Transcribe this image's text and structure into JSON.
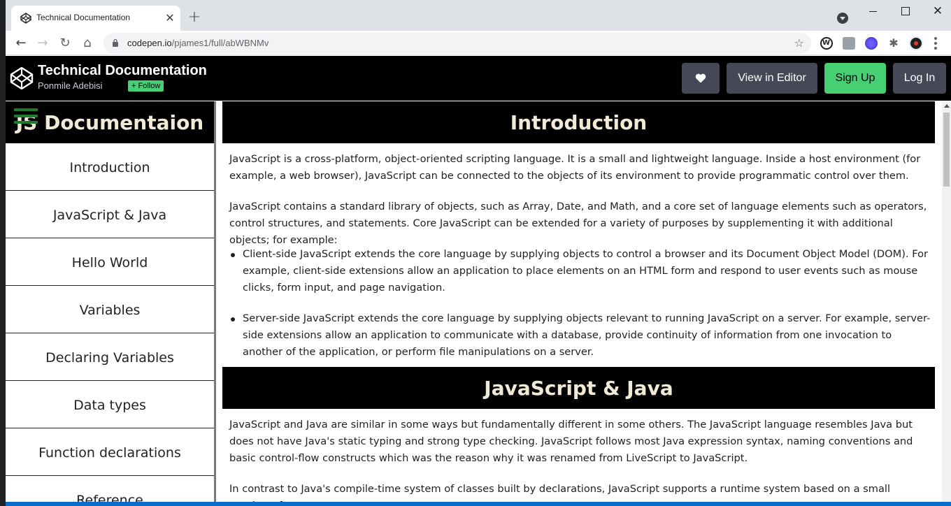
{
  "browser": {
    "tab_title": "Technical Documentation",
    "tab_close": "✕",
    "new_tab": "+",
    "url_host": "codepen.io",
    "url_path": "/pjames1/full/abWBNMv",
    "win_close": "✕"
  },
  "header": {
    "title": "Technical Documentation",
    "author": "Ponmile Adebisi",
    "follow_label": "+ Follow",
    "view_editor_label": "View in Editor",
    "signup_label": "Sign Up",
    "login_label": "Log In"
  },
  "nav": {
    "title": "JS Documentaion",
    "items": [
      {
        "label": "Introduction"
      },
      {
        "label": "JavaScript & Java"
      },
      {
        "label": "Hello World"
      },
      {
        "label": "Variables"
      },
      {
        "label": "Declaring Variables"
      },
      {
        "label": "Data types"
      },
      {
        "label": "Function declarations"
      },
      {
        "label": "Reference"
      }
    ]
  },
  "main": {
    "sections": [
      {
        "title": "Introduction",
        "paragraphs": [
          "JavaScript is a cross-platform, object-oriented scripting language. It is a small and lightweight language. Inside a host environment (for example, a web browser), JavaScript can be connected to the objects of its environment to provide programmatic control over them.",
          "JavaScript contains a standard library of objects, such as Array, Date, and Math, and a core set of language elements such as operators, control structures, and statements. Core JavaScript can be extended for a variety of purposes by supplementing it with additional objects; for example:"
        ],
        "bullets": [
          "Client-side JavaScript extends the core language by supplying objects to control a browser and its Document Object Model (DOM). For example, client-side extensions allow an application to place elements on an HTML form and respond to user events such as mouse clicks, form input, and page navigation.",
          "Server-side JavaScript extends the core language by supplying objects relevant to running JavaScript on a server. For example, server-side extensions allow an application to communicate with a database, provide continuity of information from one invocation to another of the application, or perform file manipulations on a server."
        ]
      },
      {
        "title": "JavaScript & Java",
        "paragraphs": [
          "JavaScript and Java are similar in some ways but fundamentally different in some others. The JavaScript language resembles Java but does not have Java's static typing and strong type checking. JavaScript follows most Java expression syntax, naming conventions and basic control-flow constructs which was the reason why it was renamed from LiveScript to JavaScript.",
          "In contrast to Java's compile-time system of classes built by declarations, JavaScript supports a runtime system based on a small number of"
        ]
      }
    ]
  },
  "colors": {
    "header_bg": "#000000",
    "section_title": "#f0ead6",
    "codepen_green": "#47cf73",
    "button_gray": "#444857",
    "hamburger": "#1f7a2c"
  }
}
